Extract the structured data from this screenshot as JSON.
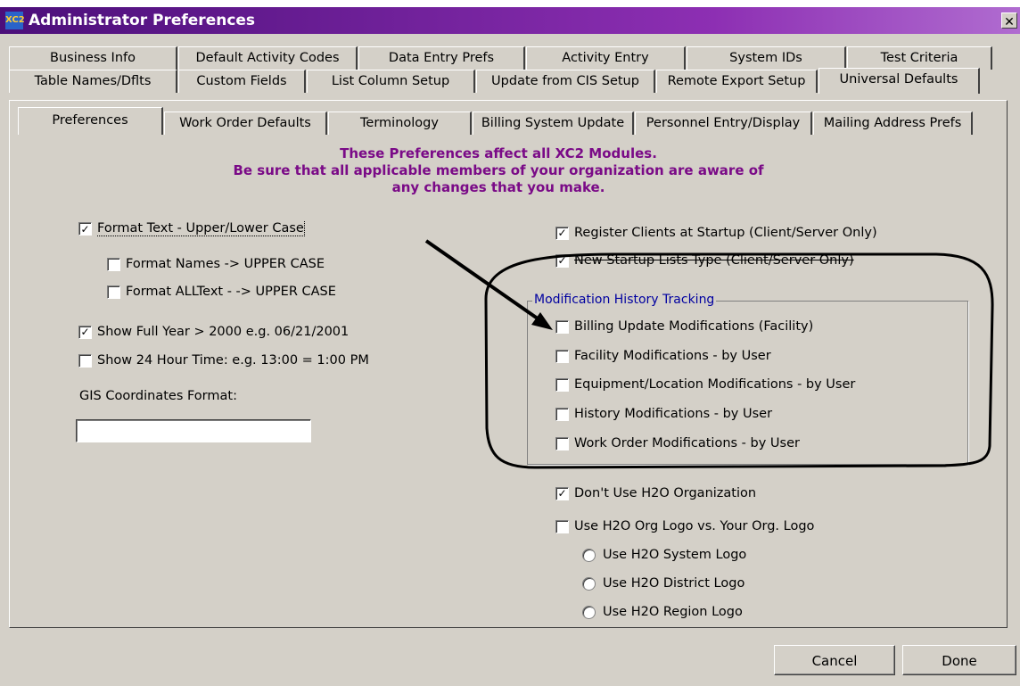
{
  "window": {
    "title": "Administrator Preferences",
    "close_symbol": "✕",
    "app_icon_text": "XC2"
  },
  "top_tabs_row1": [
    "Business Info",
    "Default Activity Codes",
    "Data Entry Prefs",
    "Activity Entry",
    "System IDs",
    "Test Criteria"
  ],
  "top_tabs_row2": [
    "Table Names/Dflts",
    "Custom Fields",
    "List Column Setup",
    "Update from CIS Setup",
    "Remote Export Setup",
    "Universal Defaults"
  ],
  "sub_tabs": [
    "Preferences",
    "Work Order Defaults",
    "Terminology",
    "Billing System Update",
    "Personnel Entry/Display",
    "Mailing Address Prefs"
  ],
  "notice": {
    "line1": "These Preferences affect all XC2 Modules.",
    "line2": "Be sure that all  applicable members of your organization are aware of",
    "line3": "any changes that you make."
  },
  "left": {
    "format_text": {
      "label": "Format Text - Upper/Lower Case",
      "checked": true
    },
    "format_names": {
      "label": "Format Names -> UPPER CASE",
      "checked": false
    },
    "format_alltext": {
      "label": "Format ALLText - -> UPPER CASE",
      "checked": false
    },
    "show_full_year": {
      "label": "Show Full Year > 2000  e.g. 06/21/2001",
      "checked": true
    },
    "show_24hour": {
      "label": "Show  24 Hour Time:  e.g. 13:00 = 1:00 PM",
      "checked": false
    },
    "gis_label": "GIS Coordinates Format:",
    "gis_value": ""
  },
  "right": {
    "register_clients": {
      "label": "Register Clients at Startup (Client/Server Only)",
      "checked": true
    },
    "new_startup": {
      "label": "New Startup Lists Type (Client/Server Only)",
      "checked": true
    },
    "mod_history": {
      "legend": "Modification History Tracking",
      "items": [
        {
          "label": "Billing Update Modifications (Facility)",
          "checked": false
        },
        {
          "label": "Facility Modifications - by User",
          "checked": false
        },
        {
          "label": "Equipment/Location Modifications - by User",
          "checked": false
        },
        {
          "label": "History Modifications - by User",
          "checked": false
        },
        {
          "label": "Work Order Modifications - by User",
          "checked": false
        }
      ]
    },
    "dont_use_h2o": {
      "label": "Don't Use H2O Organization",
      "checked": true
    },
    "use_h2o_logo": {
      "label": "Use H2O Org Logo vs. Your Org. Logo",
      "checked": false
    },
    "logo_options": [
      "Use H2O System Logo",
      "Use H2O District Logo",
      "Use H2O Region Logo"
    ]
  },
  "buttons": {
    "cancel": "Cancel",
    "done": "Done"
  },
  "check_mark": "✓"
}
